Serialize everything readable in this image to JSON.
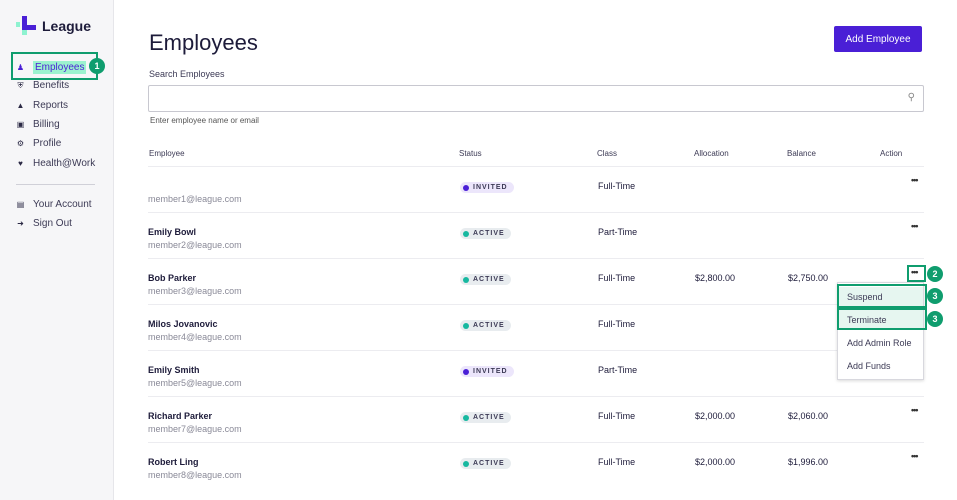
{
  "brand": {
    "name": "League"
  },
  "sidebar": {
    "items": [
      {
        "label": "Employees",
        "icon": "person-icon"
      },
      {
        "label": "Benefits",
        "icon": "shield-icon"
      },
      {
        "label": "Reports",
        "icon": "chart-icon"
      },
      {
        "label": "Billing",
        "icon": "card-icon"
      },
      {
        "label": "Profile",
        "icon": "gear-icon"
      },
      {
        "label": "Health@Work",
        "icon": "heart-icon"
      }
    ],
    "account": [
      {
        "label": "Your Account",
        "icon": "id-card-icon"
      },
      {
        "label": "Sign Out",
        "icon": "sign-out-icon"
      }
    ]
  },
  "page": {
    "title": "Employees",
    "add_button": "Add Employee",
    "search_label": "Search Employees",
    "search_hint": "Enter employee name or email",
    "search_value": ""
  },
  "table": {
    "headers": [
      "Employee",
      "Status",
      "Class",
      "Allocation",
      "Balance",
      "Action"
    ],
    "rows": [
      {
        "name": "",
        "email": "member1@league.com",
        "status": "INVITED",
        "class": "Full-Time",
        "allocation": "",
        "balance": "",
        "action": true
      },
      {
        "name": "Emily Bowl",
        "email": "member2@league.com",
        "status": "ACTIVE",
        "class": "Part-Time",
        "allocation": "",
        "balance": "",
        "action": true
      },
      {
        "name": "Bob Parker",
        "email": "member3@league.com",
        "status": "ACTIVE",
        "class": "Full-Time",
        "allocation": "$2,800.00",
        "balance": "$2,750.00",
        "action": true
      },
      {
        "name": "Milos Jovanovic",
        "email": "member4@league.com",
        "status": "ACTIVE",
        "class": "Full-Time",
        "allocation": "",
        "balance": "",
        "action": false
      },
      {
        "name": "Emily Smith",
        "email": "member5@league.com",
        "status": "INVITED",
        "class": "Part-Time",
        "allocation": "",
        "balance": "",
        "action": false
      },
      {
        "name": "Richard Parker",
        "email": "member7@league.com",
        "status": "ACTIVE",
        "class": "Full-Time",
        "allocation": "$2,000.00",
        "balance": "$2,060.00",
        "action": true
      },
      {
        "name": "Robert Ling",
        "email": "member8@league.com",
        "status": "ACTIVE",
        "class": "Full-Time",
        "allocation": "$2,000.00",
        "balance": "$1,996.00",
        "action": true
      }
    ]
  },
  "menu": {
    "items": [
      "Suspend",
      "Terminate",
      "Add Admin Role",
      "Add Funds"
    ]
  },
  "callouts": [
    "1",
    "2",
    "3",
    "3"
  ],
  "colors": {
    "primary": "#4a1fd6",
    "callout": "#0f9d6e",
    "active": "#17b8a0",
    "invited": "#4a1fd6",
    "highlight": "#9cf2cf"
  }
}
